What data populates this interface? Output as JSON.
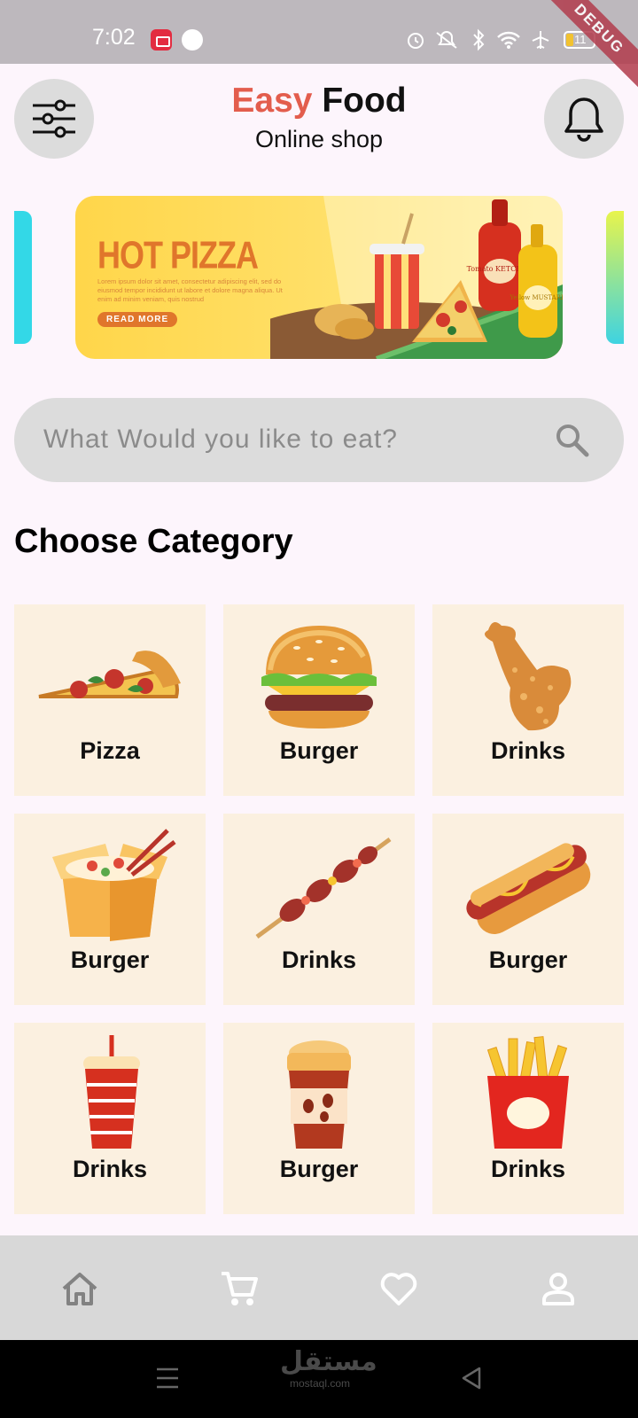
{
  "status_bar": {
    "time": "7:02",
    "battery": "11",
    "debug": "DEBUG"
  },
  "header": {
    "title_accent": "Easy",
    "title_main": "Food",
    "subtitle": "Online shop",
    "filter_icon": "sliders-icon",
    "notification_icon": "bell-icon"
  },
  "banner": {
    "heading": "HOT PIZZA",
    "text": "Lorem ipsum dolor sit amet, consectetur adipiscing elit, sed do eiusmod tempor incididunt ut labore et dolore magna aliqua. Ut enim ad minim veniam, quis nostrud",
    "button": "READ MORE",
    "ketchup_label": "Tomato KETCHUP",
    "mustard_label": "Yellow MUSTARD"
  },
  "search": {
    "placeholder": "What Would you like to eat?",
    "value": ""
  },
  "section_title": "Choose Category",
  "categories": [
    {
      "label": "Pizza",
      "icon": "pizza-icon"
    },
    {
      "label": "Burger",
      "icon": "burger-icon"
    },
    {
      "label": "Drinks",
      "icon": "chicken-leg-icon"
    },
    {
      "label": "Burger",
      "icon": "noodle-box-icon"
    },
    {
      "label": "Drinks",
      "icon": "kebab-icon"
    },
    {
      "label": "Burger",
      "icon": "hotdog-icon"
    },
    {
      "label": "Drinks",
      "icon": "soda-cup-icon"
    },
    {
      "label": "Burger",
      "icon": "coffee-cup-icon"
    },
    {
      "label": "Drinks",
      "icon": "fries-icon"
    }
  ],
  "bottom_nav": [
    "home-icon",
    "cart-icon",
    "heart-icon",
    "profile-icon"
  ],
  "watermark": {
    "arabic": "مستقل",
    "latin": "mostaql.com"
  },
  "colors": {
    "accent": "#e35d4d",
    "card_bg": "#fbf0e0",
    "page_bg": "#fdf5fc"
  }
}
